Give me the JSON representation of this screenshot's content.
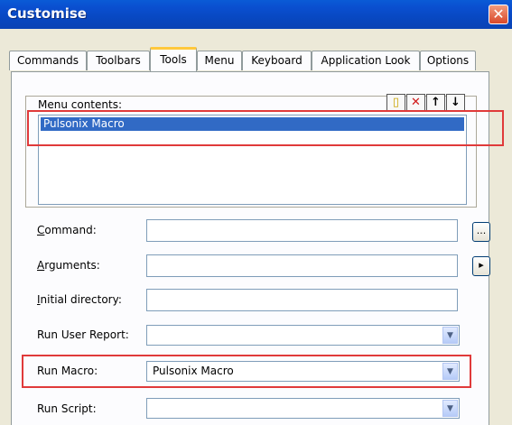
{
  "window": {
    "title": "Customise"
  },
  "icons": {
    "close": "close-icon",
    "new": "new-item-icon",
    "delete": "delete-icon",
    "up": "move-up-icon",
    "down": "move-down-icon",
    "dropdown": "chevron-down-icon"
  },
  "tabs": [
    {
      "label": "Commands"
    },
    {
      "label": "Toolbars"
    },
    {
      "label": "Tools",
      "active": true
    },
    {
      "label": "Menu"
    },
    {
      "label": "Keyboard"
    },
    {
      "label": "Application Look"
    },
    {
      "label": "Options"
    }
  ],
  "menu_contents": {
    "label": "Menu contents:",
    "items": [
      "Pulsonix Macro"
    ],
    "selected": "Pulsonix Macro"
  },
  "fields": {
    "command": {
      "label_first": "C",
      "label_rest": "ommand:",
      "value": "",
      "browse_label": "..."
    },
    "arguments": {
      "label_first": "A",
      "label_rest": "rguments:",
      "value": "",
      "arrow_label": "▸"
    },
    "initial_directory": {
      "label_first": "I",
      "label_rest": "nitial directory:",
      "value": ""
    },
    "run_user_report": {
      "label": "Run User Report:",
      "value": ""
    },
    "run_macro": {
      "label": "Run Macro:",
      "value": "Pulsonix Macro"
    },
    "run_script": {
      "label": "Run Script:",
      "value": ""
    }
  },
  "colors": {
    "highlight": "#e03a3a",
    "selection": "#316ac5",
    "titlebar": "#0a4fd0"
  }
}
